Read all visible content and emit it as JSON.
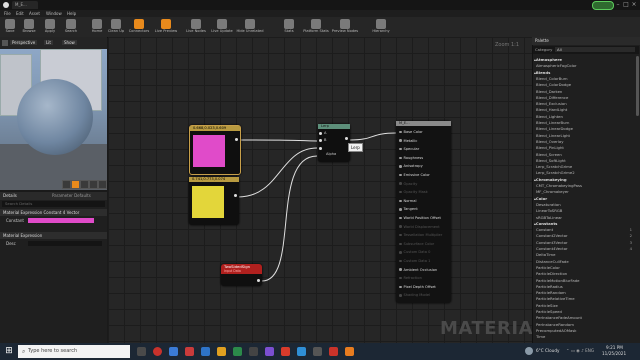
{
  "window": {
    "tab_title": "M_E...",
    "controls": [
      "–",
      "□",
      "×"
    ]
  },
  "menu": [
    "File",
    "Edit",
    "Asset",
    "Window",
    "Help"
  ],
  "toolbar": [
    {
      "label": "Save",
      "icon": "save-icon"
    },
    {
      "label": "Browse",
      "icon": "folder-icon"
    },
    {
      "label": "Apply",
      "icon": "apply-icon"
    },
    {
      "label": "Search",
      "icon": "search-icon"
    },
    {
      "label": "Home",
      "icon": "home-icon"
    },
    {
      "label": "Clean Up",
      "icon": "clean-up-icon"
    },
    {
      "label": "Connectors",
      "icon": "connectors-icon"
    },
    {
      "label": "Live Preview",
      "icon": "live-preview-icon"
    },
    {
      "label": "Live Nodes",
      "icon": "live-nodes-icon"
    },
    {
      "label": "Live Update",
      "icon": "live-update-icon"
    },
    {
      "label": "Hide Unrelated",
      "icon": "hide-unrelated-icon"
    },
    {
      "label": "Stats",
      "icon": "stats-icon"
    },
    {
      "label": "Platform Stats",
      "icon": "platform-stats-icon"
    },
    {
      "label": "Preview Nodes",
      "icon": "preview-nodes-icon"
    },
    {
      "label": "Hierarchy",
      "icon": "hierarchy-icon"
    }
  ],
  "viewport": {
    "perspective": "Perspective",
    "lit": "Lit",
    "show": "Show"
  },
  "details": {
    "tab": "Details",
    "tab2": "Parameter Defaults",
    "search_placeholder": "Search Details",
    "section1": "Material Expression Constant 4 Vector",
    "constant_label": "Constant",
    "section2": "Material Expression",
    "desc_label": "Desc"
  },
  "graph": {
    "zoom": "Zoom 1:1",
    "watermark": "MATERIAL",
    "node_pink": {
      "title": "0.668,0.023,0.609",
      "color": "#e04bc9"
    },
    "node_yellow": {
      "title": "0.741,0.773,0.074",
      "color": "#e3d63a"
    },
    "node_lerp": {
      "title": "Lerp",
      "pins": [
        "A",
        "B",
        "Alpha"
      ],
      "tooltip": "Lerp"
    },
    "node_twosided": {
      "title": "TwoSidedSign",
      "subtitle": "Input Data"
    },
    "material": {
      "title": "M_E...",
      "pins": [
        {
          "label": "Base Color",
          "active": true
        },
        {
          "label": "Metallic",
          "active": true
        },
        {
          "label": "Specular",
          "active": true
        },
        {
          "label": "Roughness",
          "active": true
        },
        {
          "label": "Anisotropy",
          "active": true
        },
        {
          "label": "Emissive Color",
          "active": true
        },
        {
          "label": "Opacity",
          "active": false
        },
        {
          "label": "Opacity Mask",
          "active": false
        },
        {
          "label": "Normal",
          "active": true
        },
        {
          "label": "Tangent",
          "active": true
        },
        {
          "label": "World Position Offset",
          "active": true
        },
        {
          "label": "World Displacement",
          "active": false
        },
        {
          "label": "Tessellation Multiplier",
          "active": false
        },
        {
          "label": "Subsurface Color",
          "active": false
        },
        {
          "label": "Custom Data 0",
          "active": false
        },
        {
          "label": "Custom Data 1",
          "active": false
        },
        {
          "label": "Ambient Occlusion",
          "active": true
        },
        {
          "label": "Refraction",
          "active": false
        },
        {
          "label": "Pixel Depth Offset",
          "active": true
        },
        {
          "label": "Shading Model",
          "active": false
        }
      ]
    }
  },
  "palette": {
    "title": "Palette",
    "category_label": "Category",
    "category_value": "All",
    "items": [
      {
        "t": "Atmosphere",
        "cat": true
      },
      {
        "t": "AtmosphericFogColor"
      },
      {
        "t": "Blends",
        "cat": true
      },
      {
        "t": "Blend_ColorBurn"
      },
      {
        "t": "Blend_ColorDodge"
      },
      {
        "t": "Blend_Darken"
      },
      {
        "t": "Blend_Difference"
      },
      {
        "t": "Blend_Exclusion"
      },
      {
        "t": "Blend_HardLight"
      },
      {
        "t": "Blend_Lighten"
      },
      {
        "t": "Blend_LinearBurn"
      },
      {
        "t": "Blend_LinearDodge"
      },
      {
        "t": "Blend_LinearLight"
      },
      {
        "t": "Blend_Overlay"
      },
      {
        "t": "Blend_PinLight"
      },
      {
        "t": "Blend_Screen"
      },
      {
        "t": "Blend_SoftLight"
      },
      {
        "t": "Lerp_ScratchGrime"
      },
      {
        "t": "Lerp_ScratchGrime2"
      },
      {
        "t": "Chromakeying",
        "cat": true
      },
      {
        "t": "CMT_ChromakeyingPass"
      },
      {
        "t": "MF_Chromakeyer"
      },
      {
        "t": "Color",
        "cat": true
      },
      {
        "t": "Desaturation"
      },
      {
        "t": "LinearToSRGB"
      },
      {
        "t": "sRGBToLinear"
      },
      {
        "t": "Constants",
        "cat": true
      },
      {
        "t": "Constant",
        "n": "1"
      },
      {
        "t": "Constant2Vector",
        "n": "2"
      },
      {
        "t": "Constant3Vector",
        "n": "3"
      },
      {
        "t": "Constant4Vector",
        "n": "4"
      },
      {
        "t": "DeltaTime"
      },
      {
        "t": "DistanceCullFade"
      },
      {
        "t": "ParticleColor"
      },
      {
        "t": "ParticleDirection"
      },
      {
        "t": "ParticleMotionBlurFade"
      },
      {
        "t": "ParticleRadius"
      },
      {
        "t": "ParticleRandom"
      },
      {
        "t": "ParticleRelativeTime"
      },
      {
        "t": "ParticleSize"
      },
      {
        "t": "ParticleSpeed"
      },
      {
        "t": "PerInstanceFadeAmount"
      },
      {
        "t": "PerInstanceRandom"
      },
      {
        "t": "PrecomputedAOMask"
      },
      {
        "t": "Time"
      }
    ]
  },
  "taskbar": {
    "search_placeholder": "Type here to search",
    "weather": "6°C Cloudy",
    "time": "9:21 PM",
    "date": "11/25/2021"
  }
}
